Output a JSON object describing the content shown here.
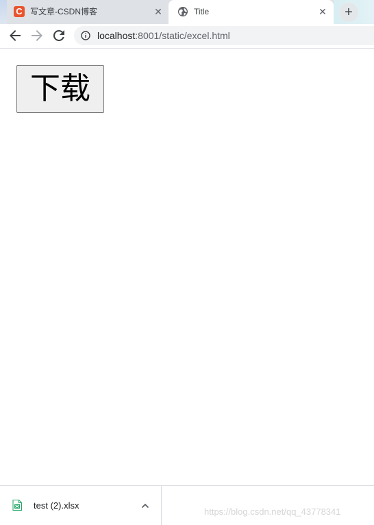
{
  "tabs": [
    {
      "title": "写文章-CSDN博客",
      "favicon": "csdn-logo",
      "favicon_letter": "C",
      "active": false
    },
    {
      "title": "Title",
      "favicon": "globe-icon",
      "active": true
    }
  ],
  "tab_close_glyph": "✕",
  "new_tab_glyph": "+",
  "omnibox": {
    "host": "localhost",
    "path": ":8001/static/excel.html"
  },
  "page": {
    "download_button_label": "下载"
  },
  "download_shelf": {
    "file_name": "test (2).xlsx",
    "watermark": "https://blog.csdn.net/qq_43778341"
  },
  "colors": {
    "csdn_brand": "#e8542e",
    "xlsx_green": "#21a366"
  }
}
